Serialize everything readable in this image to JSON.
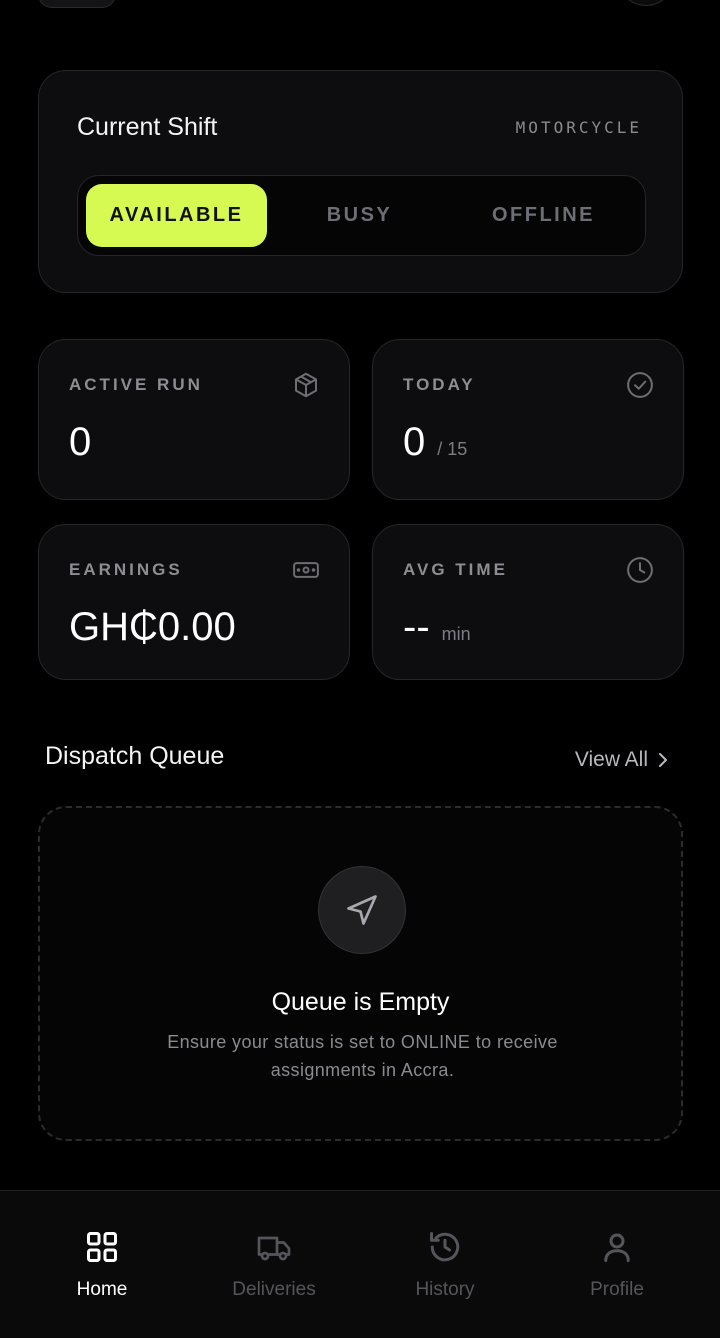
{
  "shift": {
    "title": "Current Shift",
    "vehicle": "MOTORCYCLE",
    "status_options": [
      "AVAILABLE",
      "BUSY",
      "OFFLINE"
    ],
    "selected": "AVAILABLE",
    "accent_color": "#d6fa52"
  },
  "stats": [
    {
      "label": "ACTIVE RUN",
      "value": "0",
      "suffix": "",
      "icon": "package-icon"
    },
    {
      "label": "TODAY",
      "value": "0",
      "suffix": "/ 15",
      "icon": "check-circle-icon"
    },
    {
      "label": "EARNINGS",
      "value": "GH₵0.00",
      "suffix": "",
      "icon": "cash-icon"
    },
    {
      "label": "AVG TIME",
      "value": "--",
      "suffix": "min",
      "icon": "clock-icon"
    }
  ],
  "queue": {
    "title": "Dispatch Queue",
    "view_all": "View All",
    "empty_title": "Queue is Empty",
    "empty_message": "Ensure your status is set to ONLINE to receive assignments in Accra."
  },
  "nav": {
    "items": [
      {
        "label": "Home",
        "icon": "grid-icon",
        "active": true
      },
      {
        "label": "Deliveries",
        "icon": "truck-icon",
        "active": false
      },
      {
        "label": "History",
        "icon": "history-icon",
        "active": false
      },
      {
        "label": "Profile",
        "icon": "user-icon",
        "active": false
      }
    ]
  }
}
